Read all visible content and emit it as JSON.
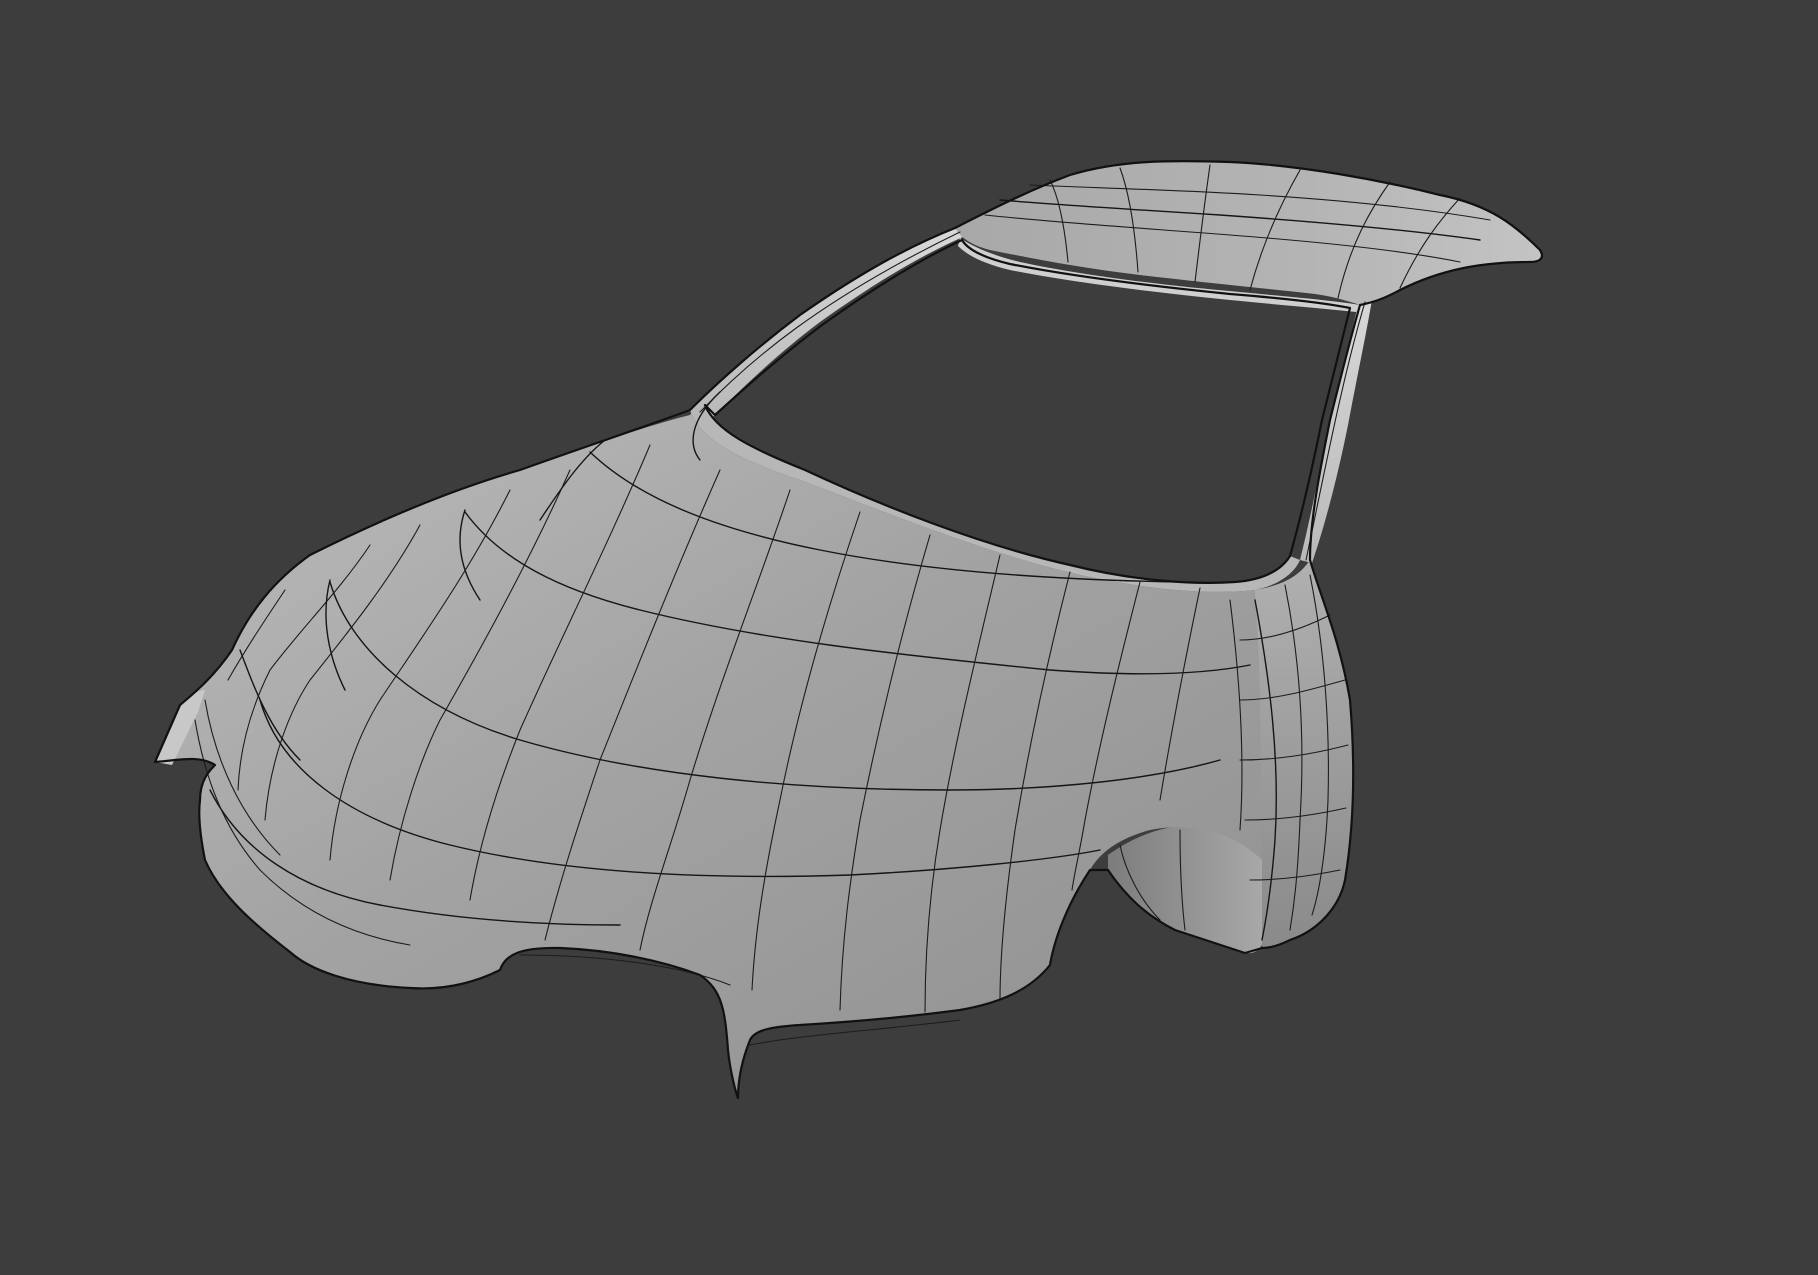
{
  "viewport": {
    "background_color": "#3d3d3d",
    "object": {
      "shading": "solid",
      "overlay": "wireframe",
      "surface_color": "#9b9b9b",
      "wire_color": "#151515"
    }
  }
}
